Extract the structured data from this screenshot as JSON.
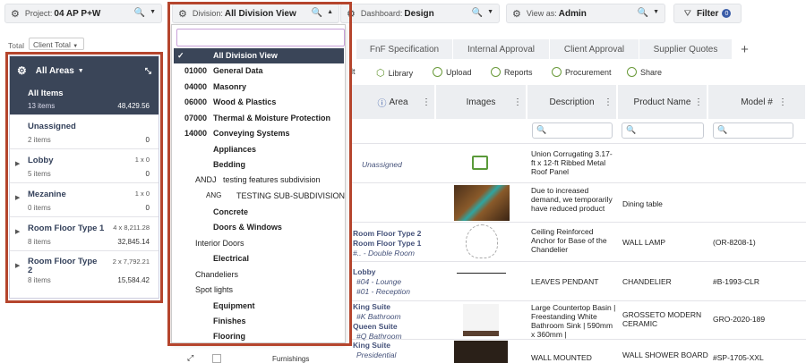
{
  "top": {
    "project_label": "Project:",
    "project": "04 AP P+W",
    "division_label": "Division:",
    "division": "All Division View",
    "dashboard_label": "Dashboard:",
    "dashboard": "Design",
    "viewas_label": "View as:",
    "viewas": "Admin",
    "filter": "Filter",
    "filter_count": "0"
  },
  "totals": {
    "total": "Total",
    "client_total": "Client Total"
  },
  "areas": {
    "header": "All Areas",
    "items": [
      {
        "name": "All Items",
        "count": "13 items",
        "value": "48,429.56"
      },
      {
        "name": "Unassigned",
        "count": "2 items",
        "value": "0"
      },
      {
        "name": "Lobby",
        "count": "5 items",
        "qty": "1 x 0",
        "value": "0"
      },
      {
        "name": "Mezanine",
        "count": "0 items",
        "qty": "1 x 0",
        "value": "0"
      },
      {
        "name": "Room Floor Type 1",
        "count": "8 items",
        "qty": "4 x 8,211.28",
        "value": "32,845.14"
      },
      {
        "name": "Room Floor Type 2",
        "count": "8 items",
        "qty": "2 x 7,792.21",
        "value": "15,584.42"
      }
    ]
  },
  "division_options": [
    {
      "code": "",
      "label": "All Division View"
    },
    {
      "code": "01000",
      "label": "General Data"
    },
    {
      "code": "04000",
      "label": "Masonry"
    },
    {
      "code": "06000",
      "label": "Wood & Plastics"
    },
    {
      "code": "07000",
      "label": "Thermal & Moisture Protection"
    },
    {
      "code": "14000",
      "label": "Conveying Systems"
    },
    {
      "code": "",
      "label": "Appliances"
    },
    {
      "code": "",
      "label": "Bedding"
    },
    {
      "code": "ANDJ",
      "label": "testing features subdivision"
    },
    {
      "code": "ANG",
      "label": "TESTING SUB-SUBDIVISION"
    },
    {
      "code": "",
      "label": "Concrete"
    },
    {
      "code": "",
      "label": "Doors & Windows"
    },
    {
      "code": "",
      "label": "Interior Doors"
    },
    {
      "code": "",
      "label": "Electrical"
    },
    {
      "code": "",
      "label": "Chandeliers"
    },
    {
      "code": "",
      "label": "Spot lights"
    },
    {
      "code": "",
      "label": "Equipment"
    },
    {
      "code": "",
      "label": "Finishes"
    },
    {
      "code": "",
      "label": "Flooring"
    }
  ],
  "tabs": [
    "FnF Specification",
    "Internal Approval",
    "Client Approval",
    "Supplier Quotes",
    "+"
  ],
  "toolbar": [
    "Library",
    "Upload",
    "Reports",
    "Procurement",
    "Share"
  ],
  "columns": [
    "Area",
    "Images",
    "Description",
    "Product Name",
    "Model #"
  ],
  "rows": [
    {
      "area": "Unassigned",
      "area2": "",
      "area3": "",
      "desc": "Union Corrugating 3.17-ft x 12-ft Ribbed Metal Roof Panel",
      "product": "",
      "model": ""
    },
    {
      "area": "",
      "area2": "",
      "area3": "",
      "desc": "Due to increased demand, we temporarily have reduced product",
      "product": "Dining table",
      "model": ""
    },
    {
      "area": "Room Floor Type 2",
      "area2": "Room Floor Type 1",
      "area3": "#.. - Double Room",
      "desc": "Ceiling Reinforced Anchor for Base of the Chandelier",
      "product": "WALL LAMP",
      "model": "(OR-8208-1)"
    },
    {
      "area": "Lobby",
      "area2": "#04 - Lounge",
      "area3": "#01 - Reception",
      "desc": "LEAVES PENDANT",
      "product": "CHANDELIER",
      "model": "#B-1993-CLR"
    },
    {
      "area": "King Suite",
      "area2": "#K Bathroom",
      "area3": "Queen Suite",
      "area4": "#Q Bathroom",
      "desc": "Large Countertop Basin | Freestanding White Bathroom Sink | 590mm x 360mm |",
      "product": "GROSSETO MODERN CERAMIC",
      "model": "GRO-2020-189"
    },
    {
      "area": "King Suite",
      "area2": "Presidential",
      "area3": "",
      "desc": "WALL MOUNTED",
      "product": "WALL SHOWER BOARD",
      "model": "#SP-1705-XXL"
    }
  ],
  "furnishings": "Furnishings"
}
